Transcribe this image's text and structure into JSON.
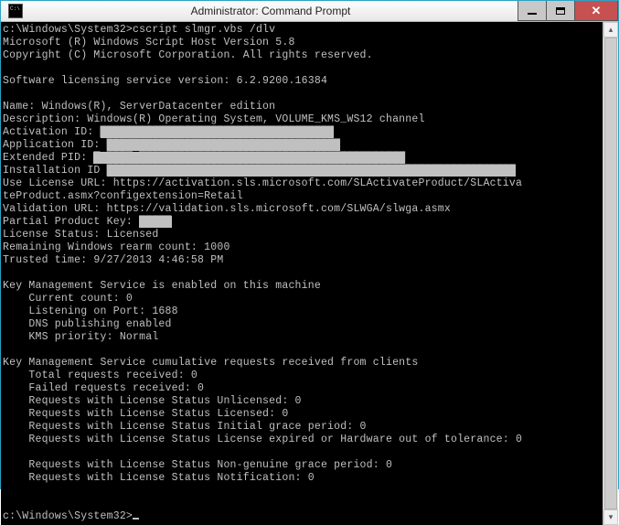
{
  "window": {
    "title": "Administrator: Command Prompt"
  },
  "prompt1": "c:\\Windows\\System32>",
  "command": "cscript slmgr.vbs /dlv",
  "lines": {
    "l1": "Microsoft (R) Windows Script Host Version 5.8",
    "l2": "Copyright (C) Microsoft Corporation. All rights reserved.",
    "l3": "Software licensing service version: 6.2.9200.16384",
    "l4": "Name: Windows(R), ServerDatacenter edition",
    "l5": "Description: Windows(R) Operating System, VOLUME_KMS_WS12 channel",
    "l6": "Activation ID:",
    "l7": "Application ID:",
    "l8": "Extended PID:",
    "l9": "Installation ID",
    "l10": "Use License URL: https://activation.sls.microsoft.com/SLActivateProduct/SLActiva",
    "l10b": "teProduct.asmx?configextension=Retail",
    "l11": "Validation URL: https://validation.sls.microsoft.com/SLWGA/slwga.asmx",
    "l12": "Partial Product Key:",
    "l13": "License Status: Licensed",
    "l14": "Remaining Windows rearm count: 1000",
    "l15": "Trusted time: 9/27/2013 4:46:58 PM",
    "l16": "Key Management Service is enabled on this machine",
    "l17": "    Current count: 0",
    "l18": "    Listening on Port: 1688",
    "l19": "    DNS publishing enabled",
    "l20": "    KMS priority: Normal",
    "l21": "Key Management Service cumulative requests received from clients",
    "l22": "    Total requests received: 0",
    "l23": "    Failed requests received: 0",
    "l24": "    Requests with License Status Unlicensed: 0",
    "l25": "    Requests with License Status Licensed: 0",
    "l26": "    Requests with License Status Initial grace period: 0",
    "l27": "    Requests with License Status License expired or Hardware out of tolerance: 0",
    "l28": "    Requests with License Status Non-genuine grace period: 0",
    "l29": "    Requests with License Status Notification: 0"
  },
  "prompt2": "c:\\Windows\\System32>",
  "redacted": {
    "activation_id": "████████████████████████████████████",
    "application_id": "████████████████████████████████████",
    "extended_pid": "█ ████ █████████████████████████████████████████",
    "installation_id": "███████████████████████████████████████████████████████████████",
    "partial_key": "█████"
  }
}
